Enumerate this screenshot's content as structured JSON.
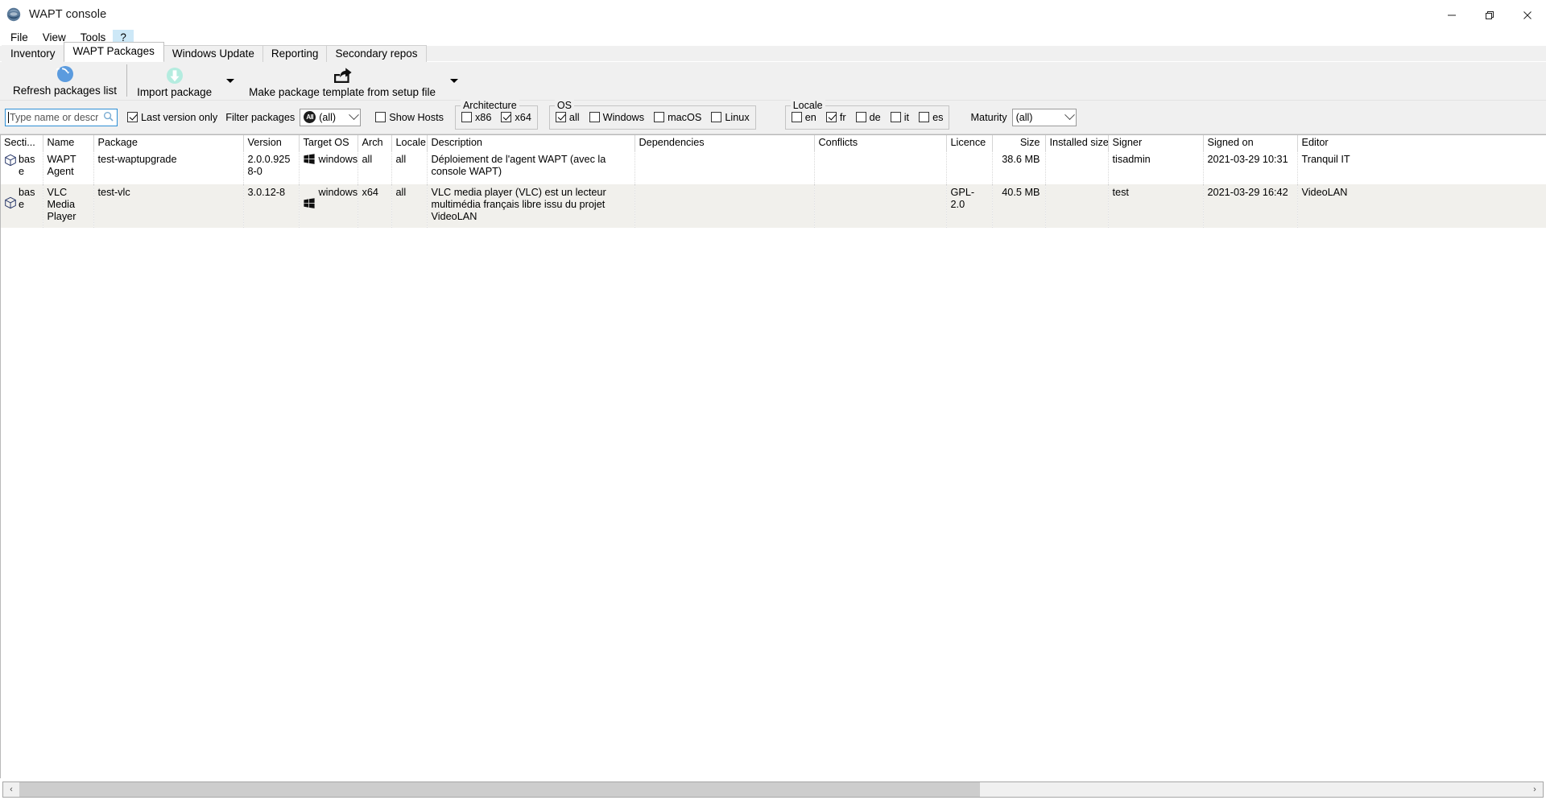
{
  "window": {
    "title": "WAPT console",
    "icon": "wapt-logo-icon",
    "controls": {
      "minimize": "—",
      "maximize": "❐",
      "close": "✕"
    }
  },
  "menubar": {
    "items": [
      {
        "label": "File",
        "active": false
      },
      {
        "label": "View",
        "active": false
      },
      {
        "label": "Tools",
        "active": false
      },
      {
        "label": "?",
        "active": true
      }
    ]
  },
  "tabs": [
    {
      "label": "Inventory",
      "selected": false
    },
    {
      "label": "WAPT Packages",
      "selected": true
    },
    {
      "label": "Windows Update",
      "selected": false
    },
    {
      "label": "Reporting",
      "selected": false
    },
    {
      "label": "Secondary repos",
      "selected": false
    }
  ],
  "toolbar": {
    "buttons": [
      {
        "label": "Refresh packages list",
        "icon": "refresh-icon"
      },
      {
        "label": "Import package",
        "icon": "download-arrow-icon",
        "has_dropdown": true
      },
      {
        "label": "Make package template from setup file",
        "icon": "share-export-icon",
        "has_dropdown": true
      }
    ]
  },
  "filters": {
    "search": {
      "value": "",
      "placeholder": "Type name or description",
      "icon": "search-icon"
    },
    "last_version_only": {
      "label": "Last version only",
      "checked": true
    },
    "filter_packages_label": "Filter packages",
    "filter_packages_value": "(all)",
    "filter_packages_badge": "All",
    "show_hosts": {
      "label": "Show Hosts",
      "checked": false
    },
    "architecture": {
      "title": "Architecture",
      "options": [
        {
          "label": "x86",
          "checked": false
        },
        {
          "label": "x64",
          "checked": true
        }
      ]
    },
    "os": {
      "title": "OS",
      "options": [
        {
          "label": "all",
          "checked": true
        },
        {
          "label": "Windows",
          "checked": false
        },
        {
          "label": "macOS",
          "checked": false
        },
        {
          "label": "Linux",
          "checked": false
        }
      ]
    },
    "locale": {
      "title": "Locale",
      "options": [
        {
          "label": "en",
          "checked": false
        },
        {
          "label": "fr",
          "checked": true
        },
        {
          "label": "de",
          "checked": false
        },
        {
          "label": "it",
          "checked": false
        },
        {
          "label": "es",
          "checked": false
        }
      ]
    },
    "maturity": {
      "label": "Maturity",
      "value": "(all)"
    }
  },
  "table": {
    "columns": [
      {
        "key": "section",
        "label": "Secti...",
        "align": "left"
      },
      {
        "key": "name",
        "label": "Name",
        "align": "left"
      },
      {
        "key": "package",
        "label": "Package",
        "align": "left"
      },
      {
        "key": "version",
        "label": "Version",
        "align": "left"
      },
      {
        "key": "target_os",
        "label": "Target OS",
        "align": "left"
      },
      {
        "key": "arch",
        "label": "Arch",
        "align": "left"
      },
      {
        "key": "locale",
        "label": "Locale",
        "align": "left"
      },
      {
        "key": "description",
        "label": "Description",
        "align": "left"
      },
      {
        "key": "dependencies",
        "label": "Dependencies",
        "align": "left"
      },
      {
        "key": "conflicts",
        "label": "Conflicts",
        "align": "left"
      },
      {
        "key": "licence",
        "label": "Licence",
        "align": "left"
      },
      {
        "key": "size",
        "label": "Size",
        "align": "right"
      },
      {
        "key": "installed_size",
        "label": "Installed size",
        "align": "right"
      },
      {
        "key": "signer",
        "label": "Signer",
        "align": "left"
      },
      {
        "key": "signed_on",
        "label": "Signed on",
        "align": "left"
      },
      {
        "key": "editor",
        "label": "Editor",
        "align": "left"
      }
    ],
    "rows": [
      {
        "section": "base",
        "name": "WAPT Agent",
        "package": "test-waptupgrade",
        "version": "2.0.0.9258-0",
        "target_os": "windows",
        "arch": "all",
        "locale": "all",
        "description": "Déploiement de l'agent WAPT (avec la console WAPT)",
        "dependencies": "",
        "conflicts": "",
        "licence": "",
        "size": "38.6 MB",
        "installed_size": "",
        "signer": "tisadmin",
        "signed_on": "2021-03-29 10:31",
        "editor": "Tranquil IT"
      },
      {
        "section": "base",
        "name": "VLC Media Player",
        "package": "test-vlc",
        "version": "3.0.12-8",
        "target_os": "windows",
        "arch": "x64",
        "locale": "all",
        "description": "VLC media player (VLC) est un lecteur multimédia français libre issu du projet VideoLAN",
        "dependencies": "",
        "conflicts": "",
        "licence": "GPL-2.0",
        "size": "40.5 MB",
        "installed_size": "",
        "signer": "test",
        "signed_on": "2021-03-29 16:42",
        "editor": "VideoLAN"
      }
    ]
  },
  "scrollbar": {
    "left_arrow": "‹",
    "right_arrow": "›"
  },
  "colors": {
    "accent": "#2d8fd5",
    "toolbar_bg": "#f0f0f0",
    "row_alt": "#f1f0ec",
    "tab_selected": "#ffffff",
    "menu_highlight": "#cde8f7"
  }
}
